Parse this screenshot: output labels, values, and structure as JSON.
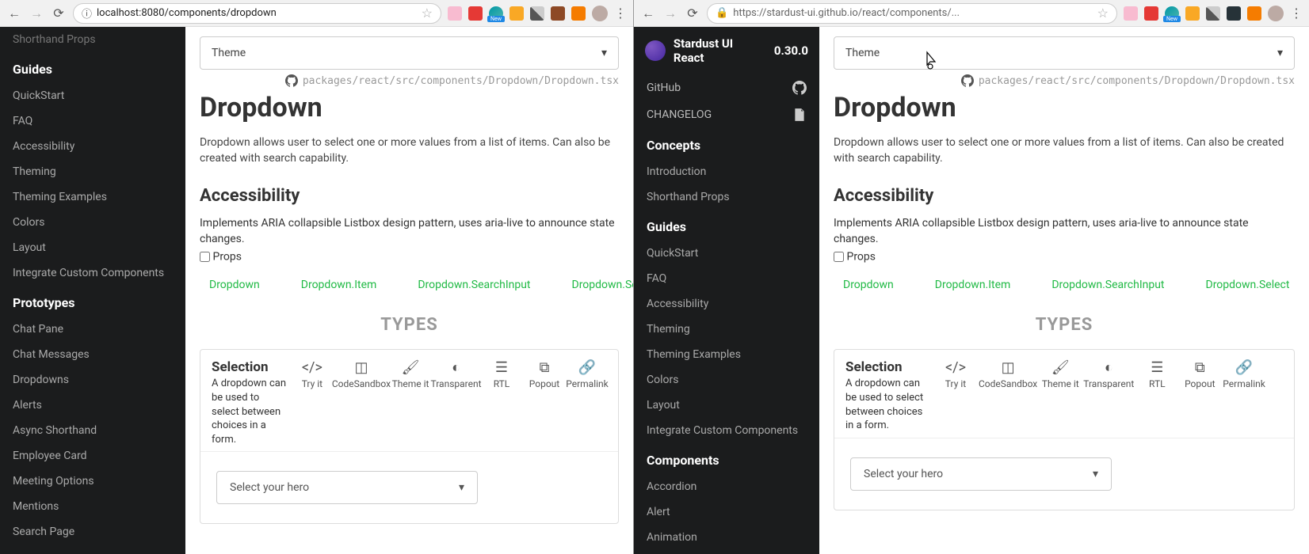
{
  "leftPane": {
    "url": "localhost:8080/components/dropdown",
    "sidebar": {
      "topDim": "Shorthand Props",
      "sections": [
        {
          "title": "Guides",
          "items": [
            "QuickStart",
            "FAQ",
            "Accessibility",
            "Theming",
            "Theming Examples",
            "Colors",
            "Layout",
            "Integrate Custom Components"
          ]
        },
        {
          "title": "Prototypes",
          "items": [
            "Chat Pane",
            "Chat Messages",
            "Dropdowns",
            "Alerts",
            "Async Shorthand",
            "Employee Card",
            "Meeting Options",
            "Mentions",
            "Search Page"
          ]
        }
      ]
    }
  },
  "rightPane": {
    "urlShown": "https://stardust-ui.github.io/react/components/...",
    "brand": {
      "name": "Stardust UI React",
      "version": "0.30.0"
    },
    "topLinks": [
      {
        "label": "GitHub",
        "icon": "github"
      },
      {
        "label": "CHANGELOG",
        "icon": "file"
      }
    ],
    "sidebar": {
      "sections": [
        {
          "title": "Concepts",
          "items": [
            "Introduction",
            "Shorthand Props"
          ]
        },
        {
          "title": "Guides",
          "items": [
            "QuickStart",
            "FAQ",
            "Accessibility",
            "Theming",
            "Theming Examples",
            "Colors",
            "Layout",
            "Integrate Custom Components"
          ]
        },
        {
          "title": "Components",
          "items": [
            "Accordion",
            "Alert",
            "Animation"
          ]
        }
      ]
    }
  },
  "content": {
    "themeLabel": "Theme",
    "srcPath": "packages/react/src/components/Dropdown/Dropdown.tsx",
    "title": "Dropdown",
    "desc": "Dropdown allows user to select one or more values from a list of items. Can also be created with search capability.",
    "accessibilityTitle": "Accessibility",
    "ariaText": "Implements ARIA collapsible Listbox design pattern, uses aria-live to announce state changes.",
    "propsLabel": "Props",
    "tabs": [
      "Dropdown",
      "Dropdown.Item",
      "Dropdown.SearchInput",
      "Dropdown.Select"
    ],
    "typesHeader": "TYPES",
    "example": {
      "title": "Selection",
      "desc": "A dropdown can be used to select between choices in a form.",
      "tools": [
        "Try it",
        "CodeSandbox",
        "Theme it",
        "Transparent",
        "RTL",
        "Popout",
        "Permalink"
      ],
      "placeholder": "Select your hero"
    }
  }
}
